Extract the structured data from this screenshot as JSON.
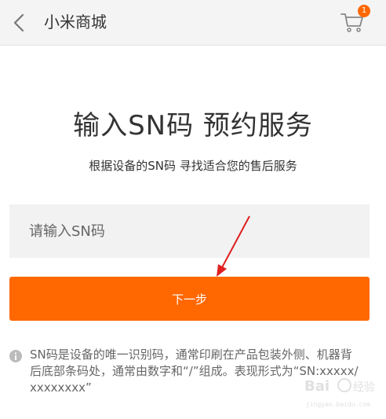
{
  "header": {
    "title": "小米商城",
    "back_icon": "chevron-left-icon",
    "cart_icon": "cart-icon",
    "cart_badge": "1"
  },
  "main": {
    "title": "输入SN码 预约服务",
    "subtitle": "根据设备的SN码 寻找适合您的售后服务",
    "sn_input": {
      "value": "",
      "placeholder": "请输入SN码"
    },
    "next_button_label": "下一步",
    "info": {
      "icon": "info-icon",
      "text": "SN码是设备的唯一识别码，通常印刷在产品包装外侧、机器背后底部条码处，通常由数字和“/”组成。表现形式为“SN:xxxxx/xxxxxxxx”"
    }
  },
  "colors": {
    "accent": "#ff6700",
    "header_bg": "#f4f4f4",
    "input_bg": "#f2f2f2",
    "annotation_arrow": "#e02020"
  },
  "watermark": {
    "logo_text": "Bai 经验"
  }
}
